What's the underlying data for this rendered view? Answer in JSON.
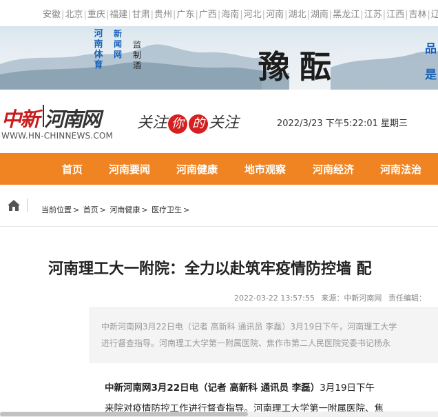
{
  "topbar": {
    "provinces": [
      "安徽",
      "北京",
      "重庆",
      "福建",
      "甘肃",
      "贵州",
      "广东",
      "广西",
      "海南",
      "河北",
      "河南",
      "湖北",
      "湖南",
      "黑龙江",
      "江苏",
      "江西",
      "吉林",
      "辽宁"
    ]
  },
  "banner": {
    "col1": "河南体育",
    "col2": "新闻网",
    "col3": "监制酒",
    "title": "豫酝",
    "edge1": "品",
    "edge2": "是"
  },
  "header": {
    "logo_red": "中新",
    "logo_black": "河南网",
    "logo_url": "WWW.HN-CHINNEWS.COM",
    "slogan_a": "关注",
    "slogan_b": "你",
    "slogan_c": "的",
    "slogan_d": "关注",
    "datetime": "2022/3/23 下午5:22:01 星期三"
  },
  "nav": {
    "items": [
      "首页",
      "河南要闻",
      "河南健康",
      "地市观察",
      "河南经济",
      "河南法治"
    ]
  },
  "breadcrumb": {
    "label": "当前位置",
    "items": [
      "首页",
      "河南健康",
      "医疗卫生"
    ]
  },
  "article": {
    "title": "河南理工大一附院：全力以赴筑牢疫情防控墙  配",
    "date": "2022-03-22 13:57:55",
    "source": "来源：",
    "source_name": "中新河南网",
    "editor": "责任编辑：",
    "summary_line1": "中新河南网3月22日电（记者 高新科 通讯员 李磊）3月19日下午，河南理工大学",
    "summary_line2": "进行督查指导。河南理工大学第一附属医院、焦作市第二人民医院党委书记杨永",
    "body_lead": "中新河南网3月22日电（记者 高新科 通讯员 李磊）",
    "body_rest": "3月19日下午",
    "body_line2": "来院对疫情防控工作进行督查指导。河南理工大学第一附属医院、焦"
  },
  "colors": {
    "nav": "#f08423",
    "logo_red": "#c91c1c",
    "banner_blue": "#1a62b8"
  }
}
